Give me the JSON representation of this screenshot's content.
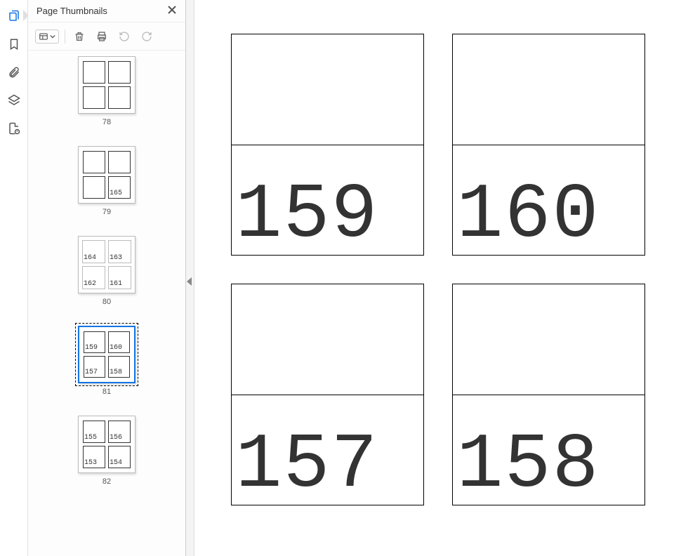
{
  "panel": {
    "title": "Page Thumbnails"
  },
  "thumbnails": [
    {
      "page_label": "78",
      "cells": [
        "",
        "",
        "",
        ""
      ],
      "noborder": false,
      "selected": false
    },
    {
      "page_label": "79",
      "cells": [
        "",
        "",
        "",
        "165"
      ],
      "noborder": false,
      "selected": false
    },
    {
      "page_label": "80",
      "cells": [
        "164",
        "163",
        "162",
        "161"
      ],
      "noborder": true,
      "selected": false
    },
    {
      "page_label": "81",
      "cells": [
        "159",
        "160",
        "157",
        "158"
      ],
      "noborder": false,
      "selected": true
    },
    {
      "page_label": "82",
      "cells": [
        "155",
        "156",
        "153",
        "154"
      ],
      "noborder": false,
      "selected": false
    }
  ],
  "main_page": {
    "cards": [
      "159",
      "160",
      "157",
      "158"
    ]
  }
}
